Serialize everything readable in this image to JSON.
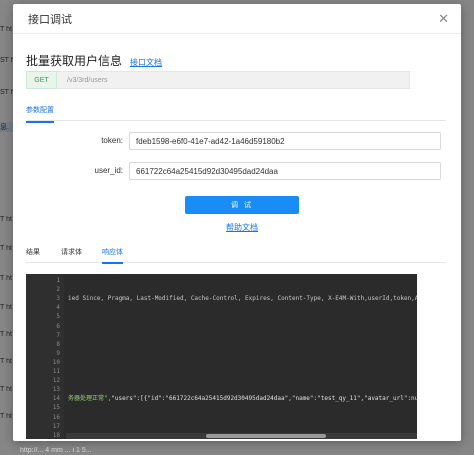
{
  "background": {
    "rows": [
      "T ht",
      "ST h",
      "ST h",
      "",
      "息.",
      "",
      "T ht",
      "T ht",
      "T ht",
      "T ht",
      "T ht",
      "T ht",
      "T ht",
      "T ht"
    ],
    "bottom_text": "http://... 4 mm ... i 1 5..."
  },
  "dialog": {
    "title": "接口调试",
    "close_glyph": "✕"
  },
  "api": {
    "name": "批量获取用户信息",
    "doc_link": "接口文档",
    "method": "GET",
    "url": "/v3/3rd/users"
  },
  "params_tab": "参数配置",
  "form": {
    "token_label": "token:",
    "token_value": "fdeb1598-e6f0-41e7-ad42-1a46d59180b2",
    "userid_label": "user_id:",
    "userid_value": "661722c64a25415d92d30495dad24daa"
  },
  "debug_button": "调 试",
  "help_link": "帮助文档",
  "response_tabs": [
    "结果",
    "请求体",
    "响应体"
  ],
  "code": {
    "line_numbers": [
      "1",
      "2",
      "3",
      "4",
      "5",
      "6",
      "7",
      "8",
      "9",
      "10",
      "11",
      "12",
      "13",
      "14",
      "15",
      "16",
      "17",
      "18"
    ],
    "line3": "ied Since, Pragma, Last-Modified, Cache-Control, Expires, Content-Type, X-E4M-With,userId,token,Access-Cont",
    "line14_a": "务器处理正常\",",
    "line14_b": "\"users\":[{\"id\":\"661722c64a25415d92d30495dad24daa\",\"name\":\"test_qy_11\",\"avatar_url\":null}]}"
  }
}
